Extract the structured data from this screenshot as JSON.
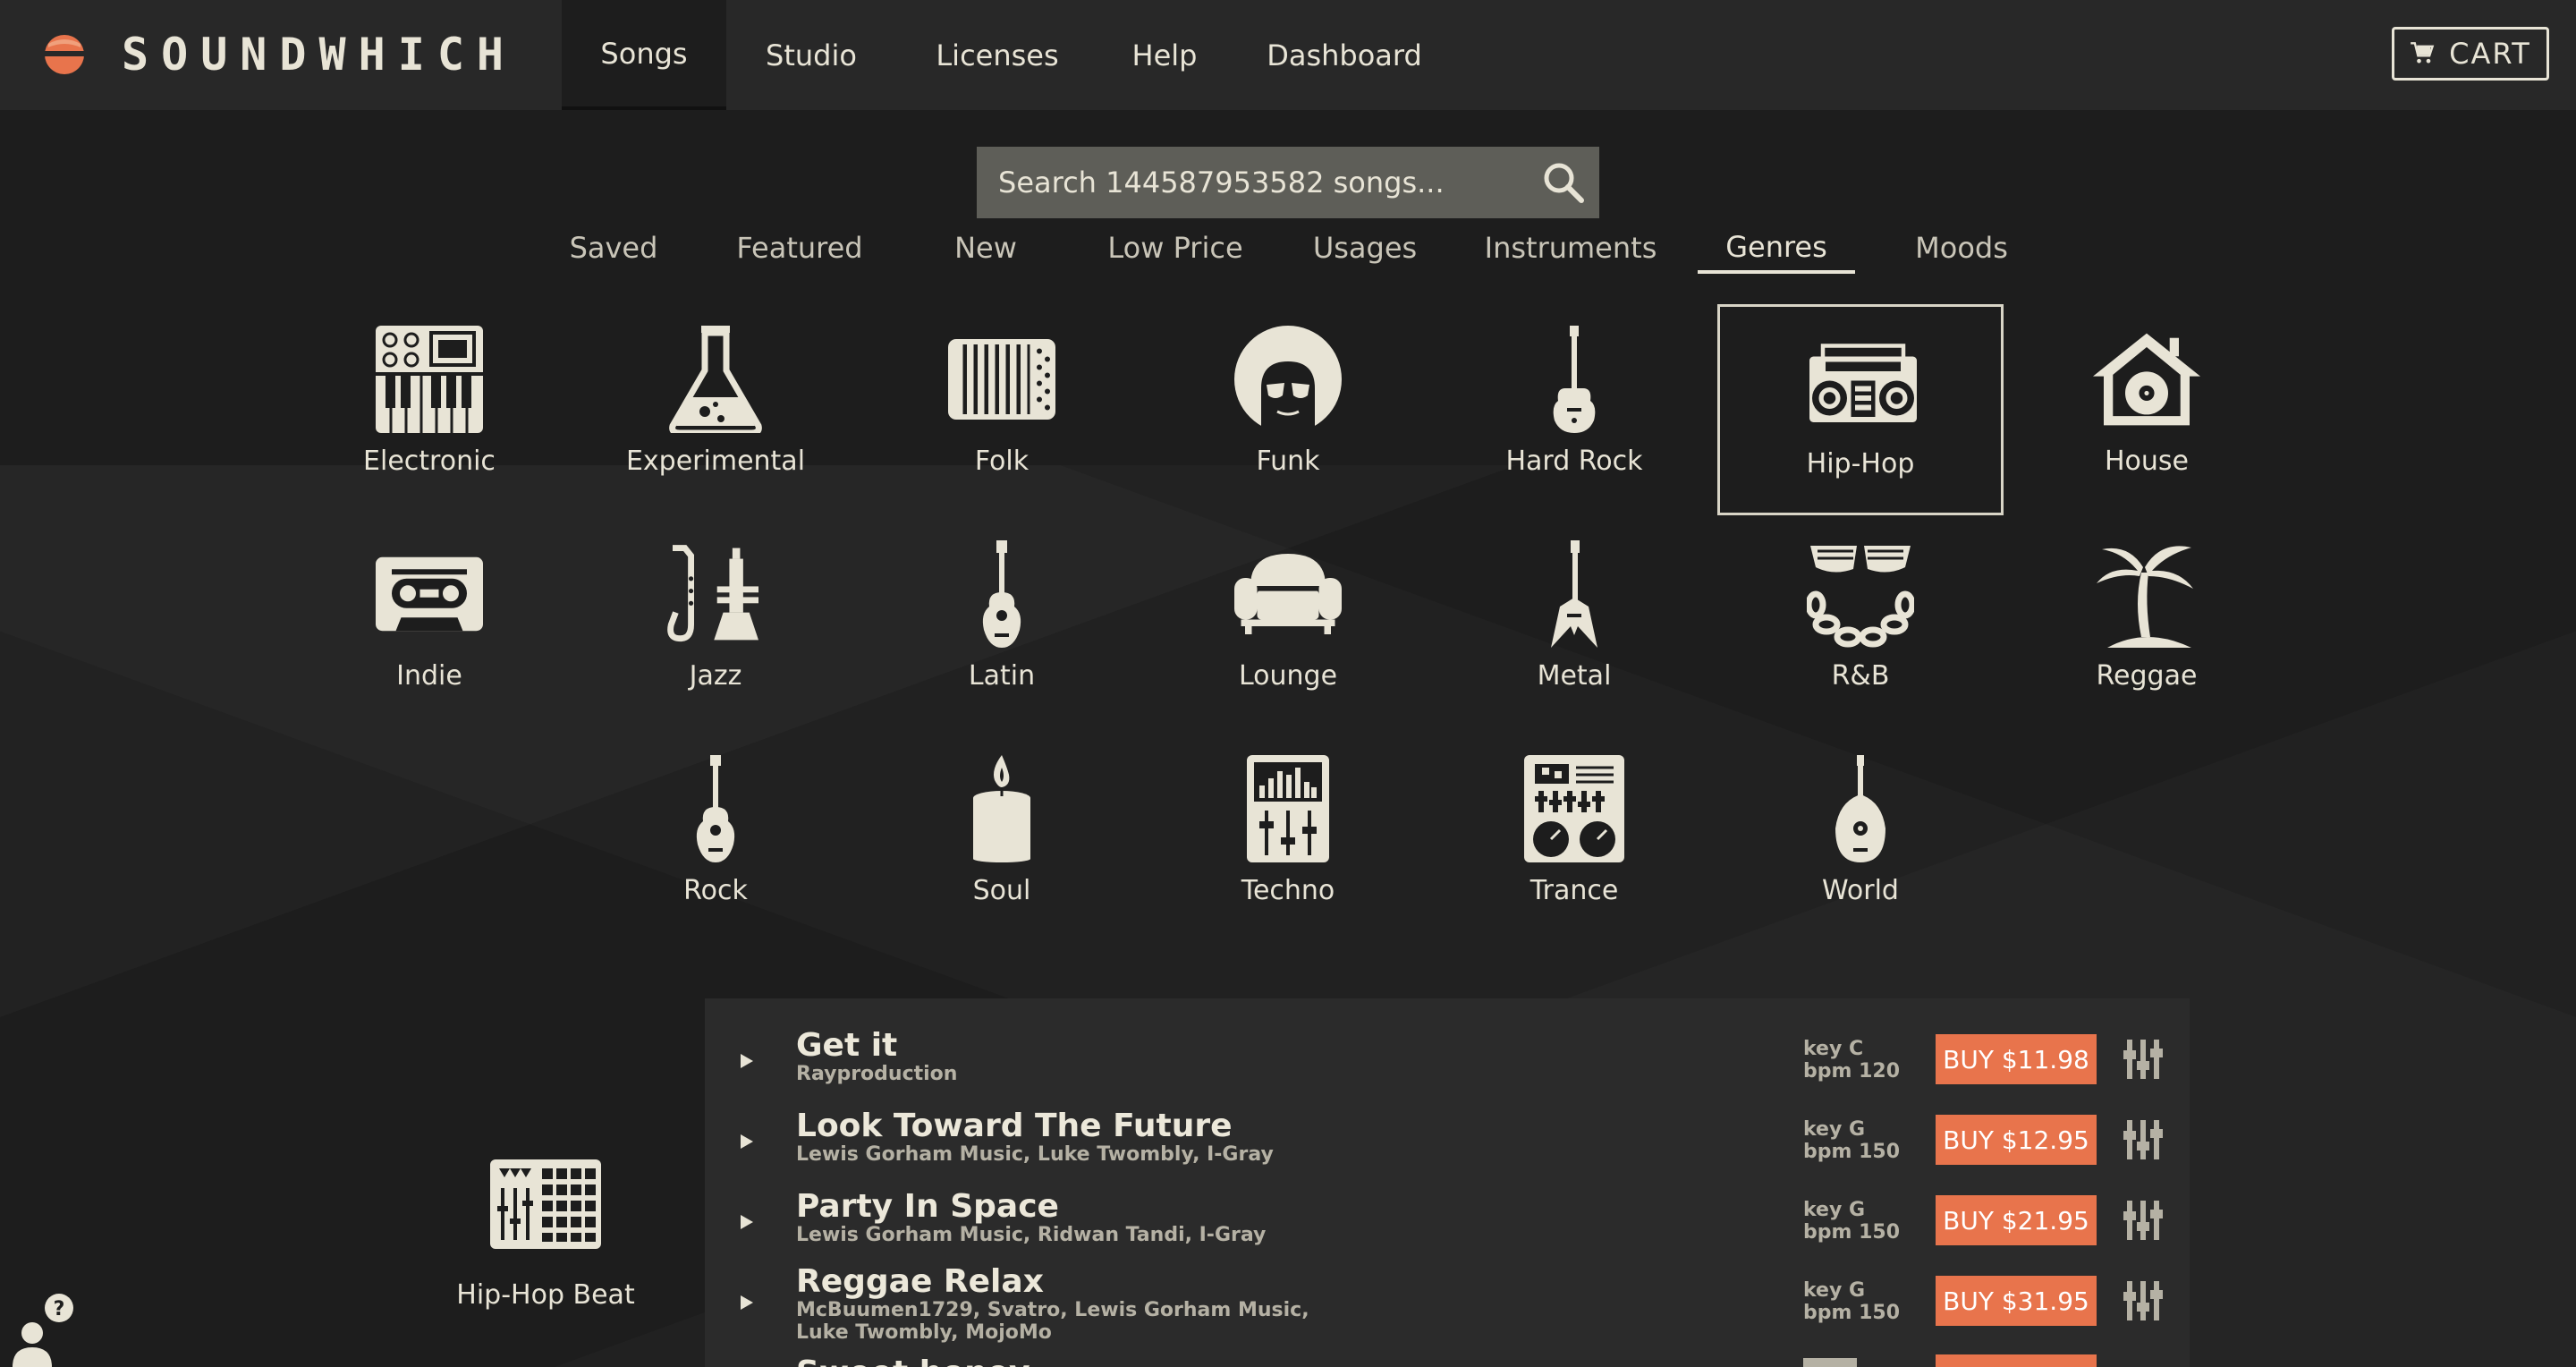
{
  "brand": {
    "name": "SOUNDWHICH",
    "accent": "#e8744c"
  },
  "nav": {
    "items": [
      {
        "label": "Songs",
        "active": true
      },
      {
        "label": "Studio"
      },
      {
        "label": "Licenses"
      },
      {
        "label": "Help"
      },
      {
        "label": "Dashboard"
      }
    ],
    "cart_label": "CART",
    "cart_icon": "cart-icon"
  },
  "search": {
    "placeholder": "Search 144587953582 songs...",
    "icon": "search-icon"
  },
  "tabs": [
    {
      "label": "Saved"
    },
    {
      "label": "Featured"
    },
    {
      "label": "New"
    },
    {
      "label": "Low Price"
    },
    {
      "label": "Usages"
    },
    {
      "label": "Instruments"
    },
    {
      "label": "Genres",
      "active": true
    },
    {
      "label": "Moods"
    }
  ],
  "genres": [
    {
      "name": "Electronic",
      "icon": "synthesizer-icon"
    },
    {
      "name": "Experimental",
      "icon": "flask-icon"
    },
    {
      "name": "Folk",
      "icon": "accordion-icon"
    },
    {
      "name": "Funk",
      "icon": "afro-icon"
    },
    {
      "name": "Hard Rock",
      "icon": "electric-guitar-icon"
    },
    {
      "name": "Hip-Hop",
      "icon": "boombox-icon",
      "selected": true
    },
    {
      "name": "House",
      "icon": "house-record-icon"
    },
    {
      "name": "Indie",
      "icon": "cassette-icon"
    },
    {
      "name": "Jazz",
      "icon": "sax-trumpet-icon"
    },
    {
      "name": "Latin",
      "icon": "acoustic-guitar-icon"
    },
    {
      "name": "Lounge",
      "icon": "armchair-icon"
    },
    {
      "name": "Metal",
      "icon": "flying-v-guitar-icon"
    },
    {
      "name": "R&B",
      "icon": "shades-chain-icon"
    },
    {
      "name": "Reggae",
      "icon": "palm-tree-icon"
    },
    {
      "name": "Rock",
      "icon": "guitar-icon"
    },
    {
      "name": "Soul",
      "icon": "candle-icon"
    },
    {
      "name": "Techno",
      "icon": "mixer-icon"
    },
    {
      "name": "Trance",
      "icon": "turntable-icon"
    },
    {
      "name": "World",
      "icon": "lute-icon"
    }
  ],
  "subgenre": {
    "name": "Hip-Hop Beat",
    "icon": "drum-machine-icon"
  },
  "songs": [
    {
      "title": "Get it",
      "artists": "Rayproduction",
      "key": "key C",
      "bpm": "bpm 120",
      "buy": "BUY $11.98"
    },
    {
      "title": "Look Toward The Future",
      "artists": "Lewis Gorham Music, Luke Twombly, I-Gray",
      "key": "key G",
      "bpm": "bpm 150",
      "buy": "BUY $12.95"
    },
    {
      "title": "Party In Space",
      "artists": "Lewis Gorham Music, Ridwan Tandi, I-Gray",
      "key": "key G",
      "bpm": "bpm 150",
      "buy": "BUY $21.95"
    },
    {
      "title": "Reggae Relax",
      "artists": "McBuumen1729, Svatro, Lewis Gorham Music, Luke Twombly, MojoMo",
      "key": "key G",
      "bpm": "bpm 150",
      "buy": "BUY $31.95"
    },
    {
      "title": "Sweet honey",
      "artists": "",
      "key": "",
      "bpm": "",
      "buy": ""
    }
  ],
  "help_widget": {
    "icon": "help-user-icon",
    "badge": "?"
  }
}
